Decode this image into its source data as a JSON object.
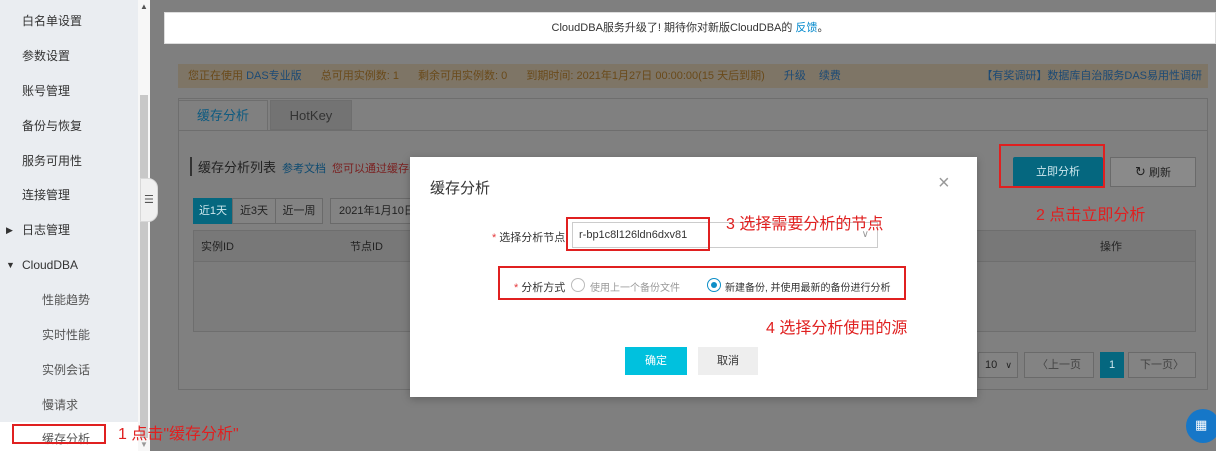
{
  "sidebar": {
    "items": [
      {
        "label": "白名单设置"
      },
      {
        "label": "参数设置"
      },
      {
        "label": "账号管理"
      },
      {
        "label": "备份与恢复"
      },
      {
        "label": "服务可用性"
      },
      {
        "label": "连接管理"
      },
      {
        "label": "日志管理"
      },
      {
        "label": "CloudDBA"
      },
      {
        "label": "性能趋势"
      },
      {
        "label": "实时性能"
      },
      {
        "label": "实例会话"
      },
      {
        "label": "慢请求"
      },
      {
        "label": "缓存分析"
      }
    ]
  },
  "banner": {
    "text": "CloudDBA服务升级了! 期待你对新版CloudDBA的",
    "link": "反馈",
    "suffix": "。"
  },
  "infobar": {
    "using": "您正在使用",
    "edition": "DAS专业版",
    "total": "总可用实例数: 1",
    "remaining": "剩余可用实例数: 0",
    "expire": "到期时间: 2021年1月27日 00:00:00(15 天后到期)",
    "upgrade": "升级",
    "renew": "续费",
    "survey": "【有奖调研】数据库自治服务DAS易用性调研"
  },
  "tabs": [
    {
      "label": "缓存分析"
    },
    {
      "label": "HotKey"
    }
  ],
  "list": {
    "title": "缓存分析列表",
    "doc": "参考文档",
    "warn": "您可以通过缓存分"
  },
  "buttons": {
    "analyze": "立即分析",
    "refresh": "刷新"
  },
  "ranges": [
    {
      "label": "近1天"
    },
    {
      "label": "近3天"
    },
    {
      "label": "近一周"
    }
  ],
  "date": "2021年1月10日",
  "table": {
    "col_instance": "实例ID",
    "col_node": "节点ID",
    "col_action": "操作"
  },
  "pagination": {
    "size": "10",
    "prev": "上一页",
    "page": "1",
    "next": "下一页"
  },
  "modal": {
    "title": "缓存分析",
    "node_label": "选择分析节点",
    "node_value": "r-bp1c8l126ldn6dxv81",
    "method_label": "分析方式",
    "option_prev": "使用上一个备份文件",
    "option_new": "新建备份, 并使用最新的备份进行分析",
    "ok": "确定",
    "cancel": "取消"
  },
  "annotations": {
    "step1": "1 点击\"缓存分析\"",
    "step2": "2 点击立即分析",
    "step3": "3 选择需要分析的节点",
    "step4": "4 选择分析使用的源"
  }
}
